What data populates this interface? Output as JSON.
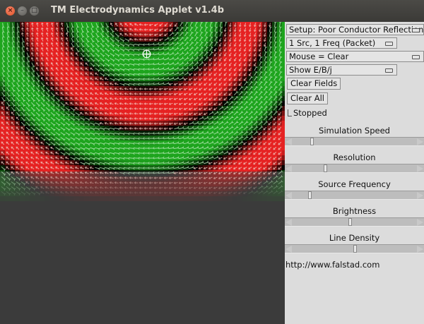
{
  "window": {
    "title": "TM Electrodynamics Applet v1.4b",
    "close_glyph": "×",
    "min_glyph": "–",
    "max_glyph": "□"
  },
  "controls": {
    "setup_choice": "Setup: Poor Conductor Reflection",
    "source_choice": "1 Src, 1 Freq (Packet)",
    "mouse_choice": "Mouse = Clear",
    "show_choice": "Show E/B/j",
    "clear_fields_button": "Clear Fields",
    "clear_all_button": "Clear All",
    "stopped_checkbox": "Stopped",
    "stopped_checked": true
  },
  "sliders": [
    {
      "label": "Simulation Speed",
      "value": 0.14
    },
    {
      "label": "Resolution",
      "value": 0.25
    },
    {
      "label": "Source Frequency",
      "value": 0.12
    },
    {
      "label": "Brightness",
      "value": 0.45
    },
    {
      "label": "Line Density",
      "value": 0.49
    }
  ],
  "footer": {
    "url": "http://www.falstad.com"
  },
  "colors": {
    "field_red": "#e62222",
    "field_green": "#1ea51e",
    "arrow_light": "#c8f0c8",
    "arrow_dark": "#f2d2c8",
    "canvas_background": "#3b3b3b"
  },
  "icons": {
    "window_close": "close-icon",
    "mouse_crosshair": "crosshair-icon"
  }
}
